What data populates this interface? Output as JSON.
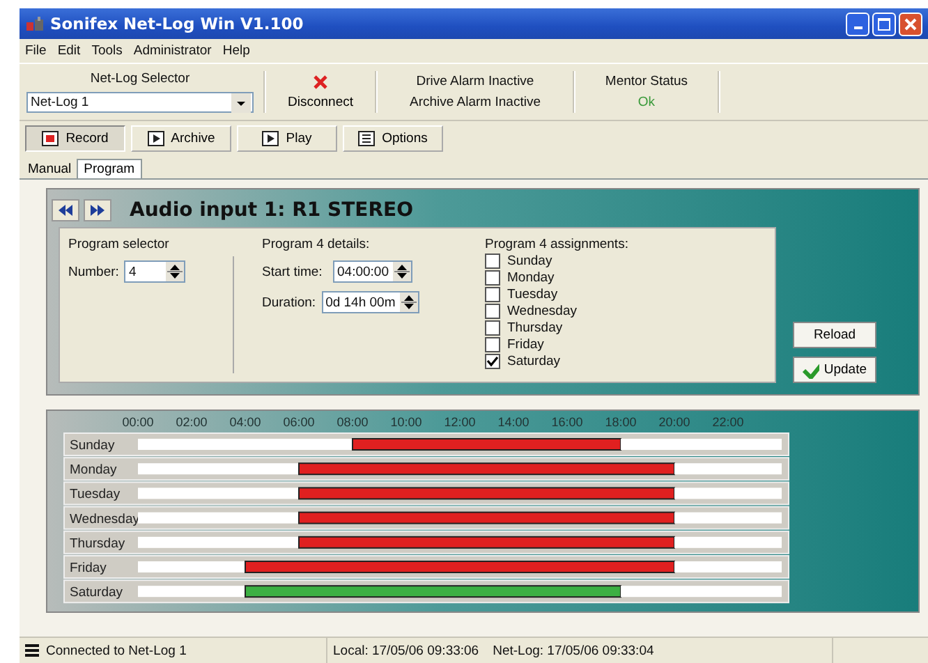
{
  "window": {
    "title": "Sonifex Net-Log Win V1.100"
  },
  "menu": [
    "File",
    "Edit",
    "Tools",
    "Administrator",
    "Help"
  ],
  "toolbar": {
    "selector_label": "Net-Log Selector",
    "selector_value": "Net-Log 1",
    "disconnect": "Disconnect",
    "drive_alarm": "Drive Alarm Inactive",
    "archive_alarm": "Archive Alarm Inactive",
    "mentor_label": "Mentor Status",
    "mentor_value": "Ok"
  },
  "mode_tabs": [
    {
      "label": "Record",
      "selected": true,
      "kind": "record"
    },
    {
      "label": "Archive",
      "selected": false,
      "kind": "play"
    },
    {
      "label": "Play",
      "selected": false,
      "kind": "play"
    },
    {
      "label": "Options",
      "selected": false,
      "kind": "options"
    }
  ],
  "sub_tabs": [
    {
      "label": "Manual",
      "selected": false
    },
    {
      "label": "Program",
      "selected": true
    }
  ],
  "panel": {
    "title": "Audio input 1: R1 STEREO",
    "selector": {
      "heading": "Program selector",
      "number_label": "Number:",
      "number": "4"
    },
    "details": {
      "heading": "Program 4 details:",
      "start_label": "Start time:",
      "start": "04:00:00",
      "duration_label": "Duration:",
      "duration": "0d 14h 00m"
    },
    "assignments": {
      "heading": "Program 4 assignments:",
      "days": [
        {
          "label": "Sunday",
          "checked": false
        },
        {
          "label": "Monday",
          "checked": false
        },
        {
          "label": "Tuesday",
          "checked": false
        },
        {
          "label": "Wednesday",
          "checked": false
        },
        {
          "label": "Thursday",
          "checked": false
        },
        {
          "label": "Friday",
          "checked": false
        },
        {
          "label": "Saturday",
          "checked": true
        }
      ]
    },
    "buttons": {
      "reload": "Reload",
      "update": "Update"
    }
  },
  "schedule": {
    "chart_data": {
      "type": "bar",
      "orientation": "horizontal",
      "stacked": true,
      "categories": [
        "Sunday",
        "Monday",
        "Tuesday",
        "Wednesday",
        "Thursday",
        "Friday",
        "Saturday"
      ],
      "series": [
        {
          "color": "#ffffff",
          "values": [
            8,
            6,
            6,
            6,
            6,
            4,
            4
          ]
        },
        {
          "color": "#e02020",
          "values": [
            10,
            14,
            14,
            14,
            14,
            16,
            null
          ]
        },
        {
          "color": "#3cb043",
          "values": [
            null,
            null,
            null,
            null,
            null,
            null,
            14
          ]
        },
        {
          "color": "#ffffff",
          "values": [
            6,
            4,
            4,
            4,
            4,
            4,
            6
          ]
        }
      ],
      "xlim": [
        0,
        24
      ],
      "xticks": [
        {
          "value": 0,
          "label": "00:00"
        },
        {
          "value": 2,
          "label": "02:00"
        },
        {
          "value": 4,
          "label": "04:00"
        },
        {
          "value": 6,
          "label": "06:00"
        },
        {
          "value": 8,
          "label": "08:00"
        },
        {
          "value": 10,
          "label": "10:00"
        },
        {
          "value": 12,
          "label": "12:00"
        },
        {
          "value": 14,
          "label": "14:00"
        },
        {
          "value": 16,
          "label": "16:00"
        },
        {
          "value": 18,
          "label": "18:00"
        },
        {
          "value": 20,
          "label": "20:00"
        },
        {
          "value": 22,
          "label": "22:00"
        }
      ]
    }
  },
  "status_bar": {
    "connection": "Connected to Net-Log 1",
    "local_time": "Local: 17/05/06 09:33:06",
    "netlog_time": "Net-Log: 17/05/06 09:33:04"
  }
}
